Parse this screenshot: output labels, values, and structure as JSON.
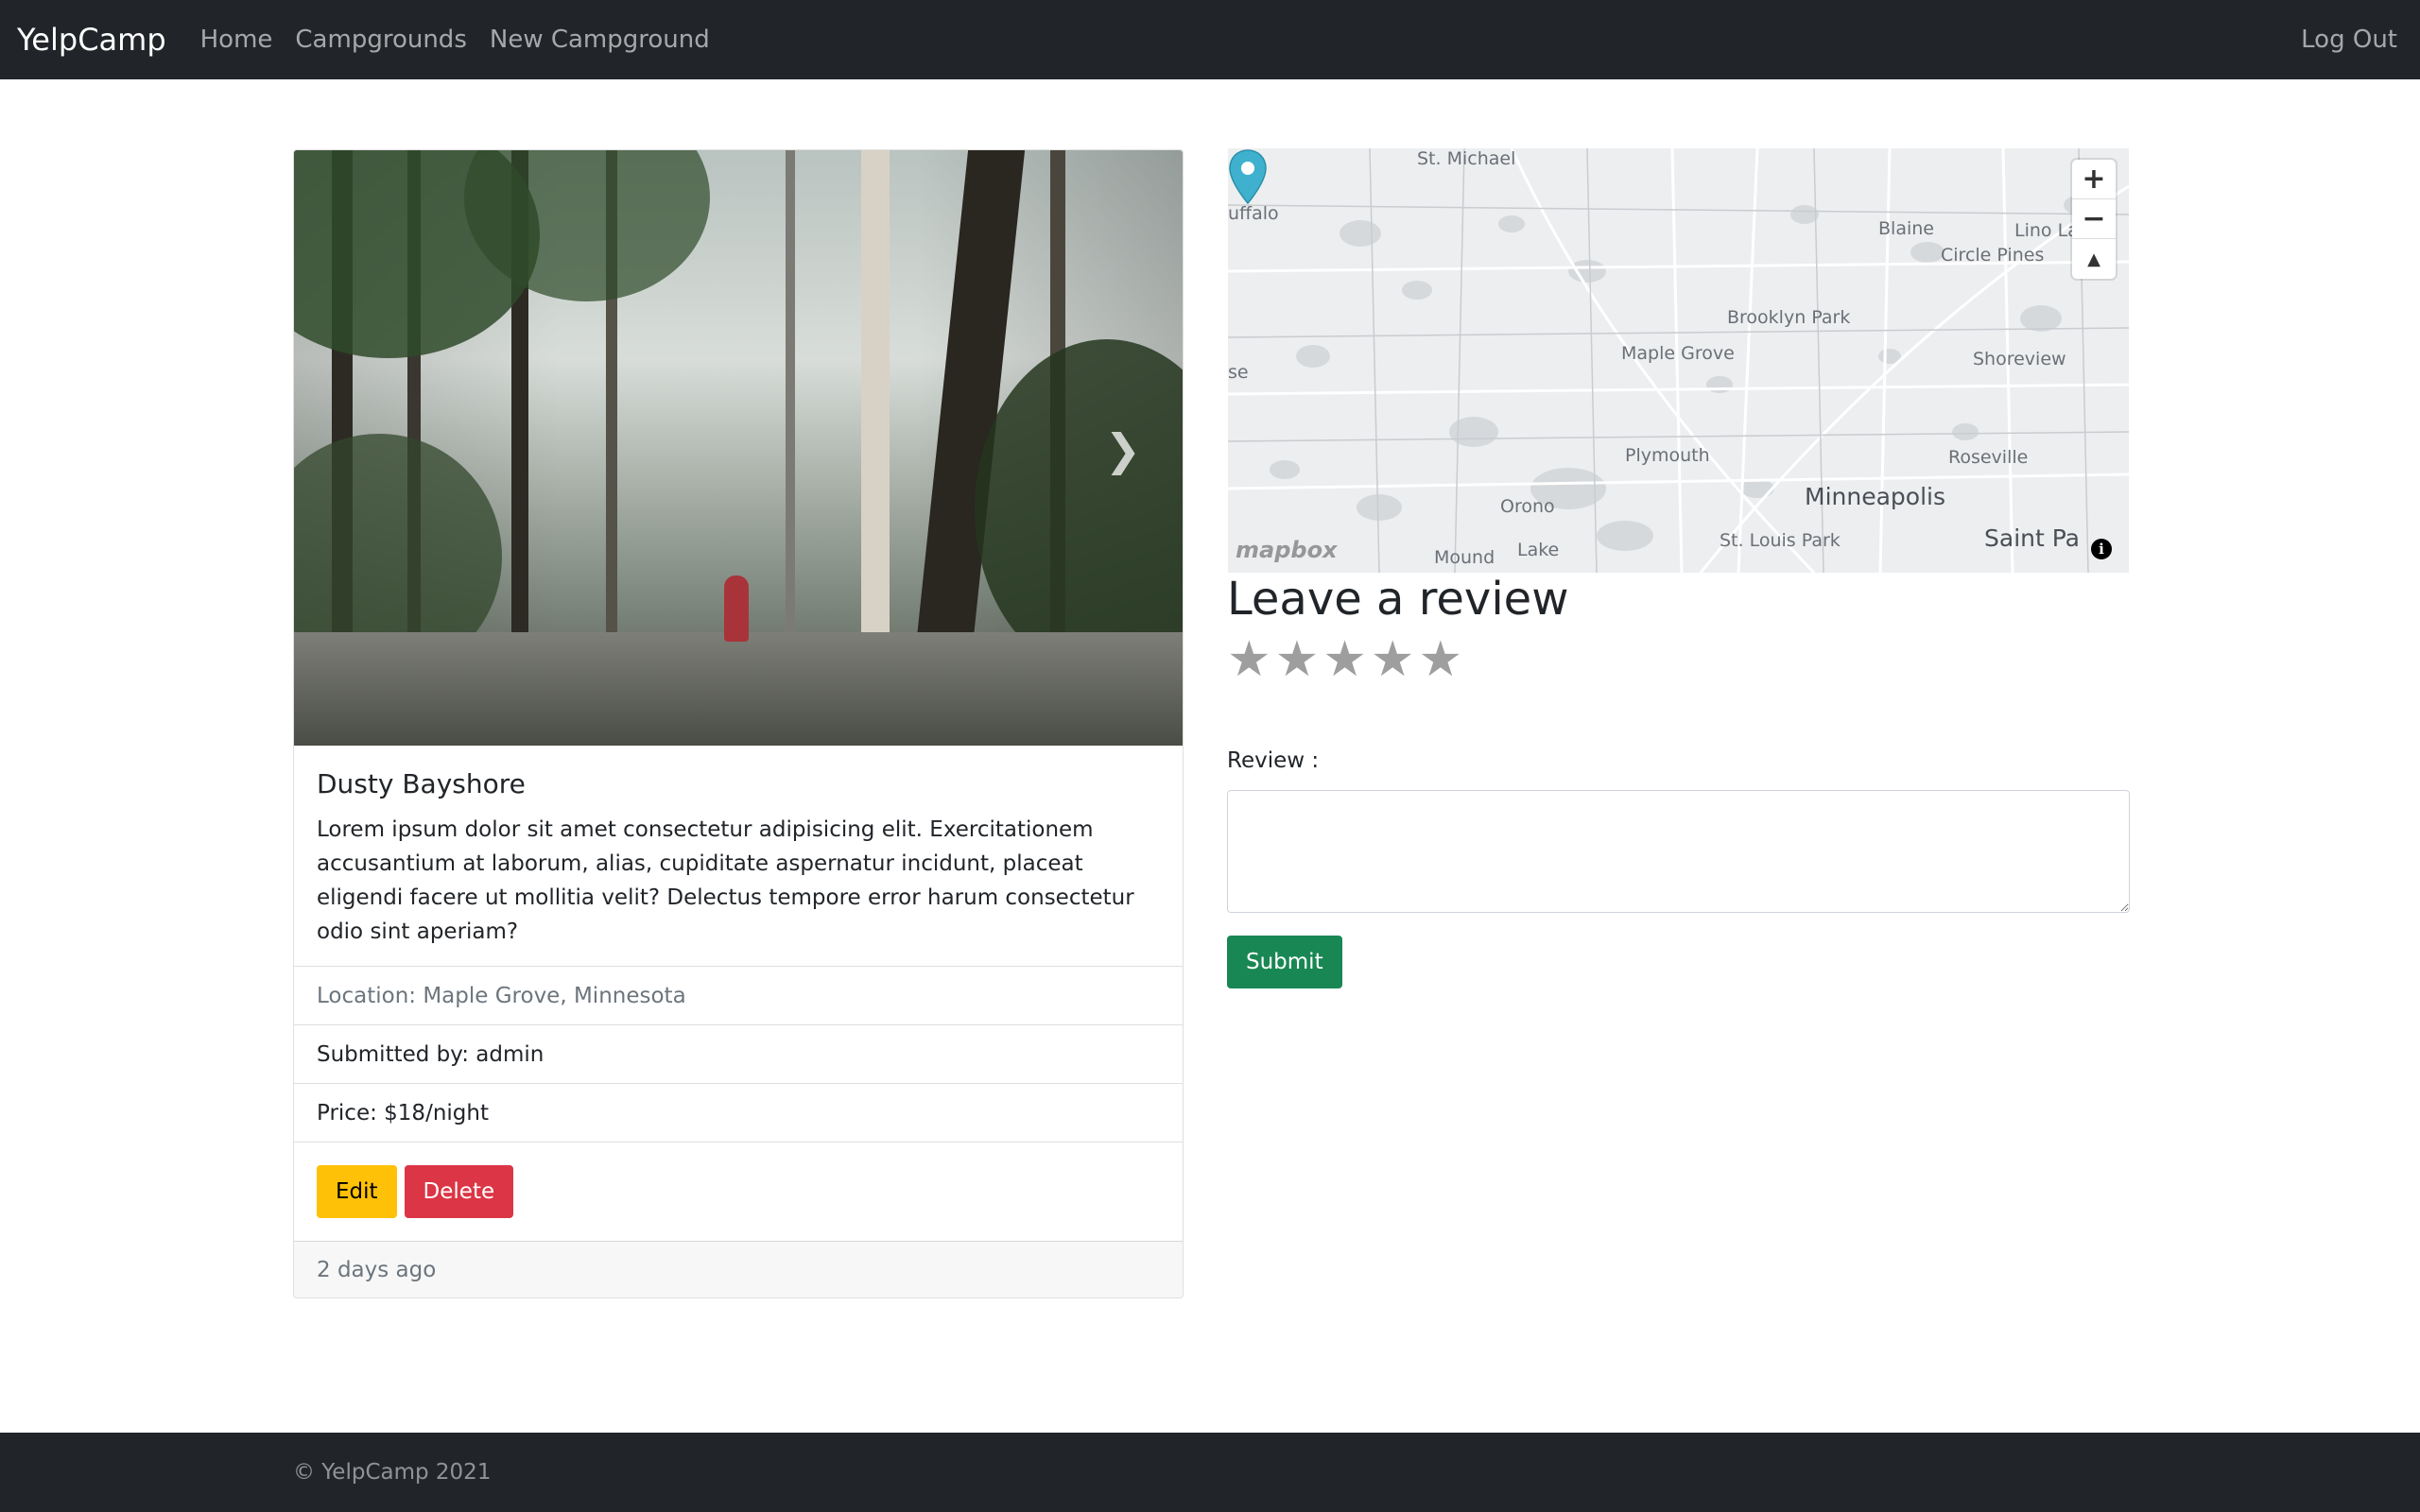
{
  "navbar": {
    "brand": "YelpCamp",
    "links": [
      "Home",
      "Campgrounds",
      "New Campground"
    ],
    "logout": "Log Out"
  },
  "campground": {
    "title": "Dusty Bayshore",
    "description": "Lorem ipsum dolor sit amet consectetur adipisicing elit. Exercitationem accusantium at laborum, alias, cupiditate aspernatur incidunt, placeat eligendi facere ut mollitia velit? Delectus tempore error harum consectetur odio sint aperiam?",
    "location": "Location: Maple Grove, Minnesota",
    "submitted_by": "Submitted by: admin",
    "price": "Price: $18/night",
    "edit_label": "Edit",
    "delete_label": "Delete",
    "posted": "2 days ago"
  },
  "map": {
    "labels": [
      "St. Michael",
      "uffalo",
      "Blaine",
      "Lino La",
      "Circle Pines",
      "Brooklyn Park",
      "Maple Grove",
      "se",
      "Shoreview",
      "Plymouth",
      "Roseville",
      "Orono",
      "Minneapolis",
      "Mound",
      "Lake",
      "St. Louis Park",
      "Saint Pa"
    ],
    "zoom_in": "+",
    "zoom_out": "−",
    "compass": "▲",
    "logo": "mapbox",
    "info": "i"
  },
  "review": {
    "heading": "Leave a review",
    "stars": 5,
    "label": "Review :",
    "textarea_value": "",
    "submit_label": "Submit"
  },
  "footer": {
    "text": "© YelpCamp 2021"
  },
  "colors": {
    "navbar_bg": "#212529",
    "warning": "#ffc107",
    "danger": "#dc3545",
    "success": "#198754",
    "pin": "#3fb1ce"
  }
}
